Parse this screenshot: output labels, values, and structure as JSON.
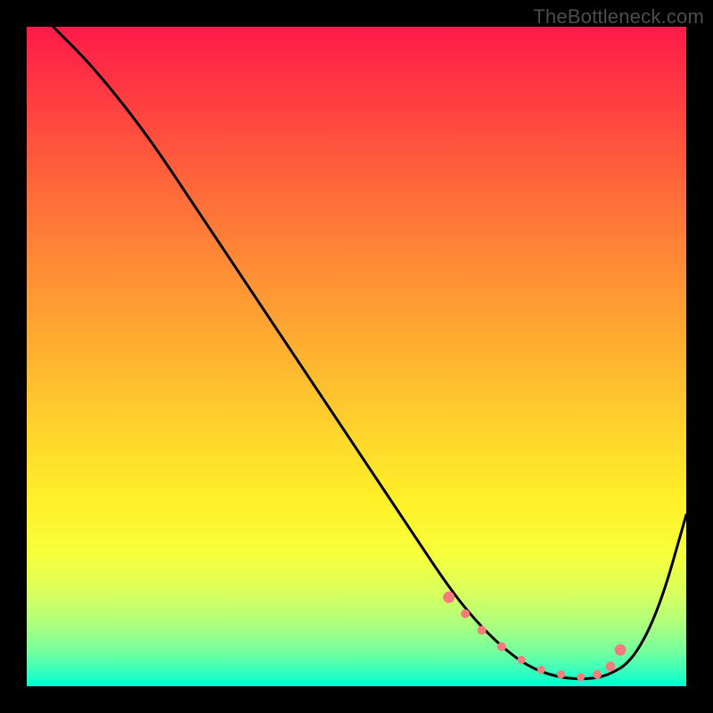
{
  "watermark": "TheBottleneck.com",
  "chart_data": {
    "type": "line",
    "title": "",
    "xlabel": "",
    "ylabel": "",
    "xlim": [
      0,
      100
    ],
    "ylim": [
      0,
      100
    ],
    "curve": {
      "x": [
        4,
        10,
        18,
        26,
        34,
        42,
        50,
        58,
        64,
        68,
        72,
        76,
        80,
        84,
        88,
        92,
        96,
        100
      ],
      "y": [
        100,
        94,
        84,
        72,
        60,
        48,
        36,
        24,
        15,
        10,
        6,
        3,
        1.5,
        1,
        1.5,
        4,
        12,
        26
      ]
    },
    "markers": {
      "x": [
        64,
        66.5,
        69,
        72,
        75,
        78,
        81,
        84,
        86.5,
        88.5,
        90
      ],
      "y": [
        13.5,
        11,
        8.5,
        6,
        4,
        2.5,
        1.8,
        1.4,
        1.8,
        3,
        5.5
      ],
      "sizes": [
        6.5,
        5,
        5,
        5,
        4.5,
        4.5,
        4.5,
        4.5,
        5,
        5.5,
        6.5
      ]
    },
    "colors": {
      "curve": "#000000",
      "marker": "#f47c7c"
    }
  }
}
